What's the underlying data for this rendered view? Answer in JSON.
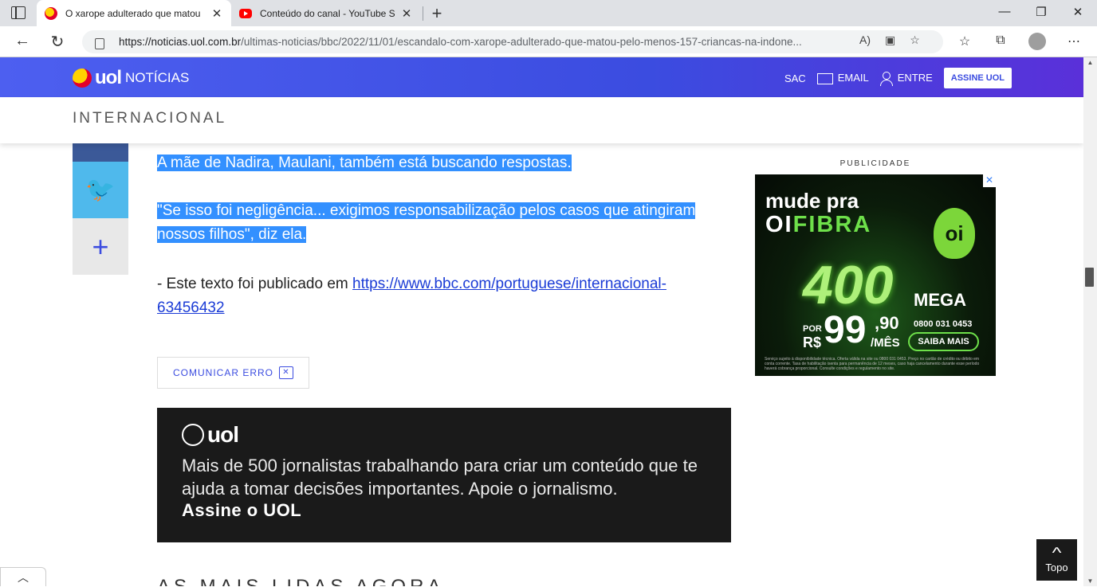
{
  "browser": {
    "tabs": [
      {
        "title": "O xarope adulterado que matou",
        "active": true
      },
      {
        "title": "Conteúdo do canal - YouTube St",
        "active": false
      }
    ],
    "url_host": "https://noticias.uol.com.br",
    "url_path": "/ultimas-noticias/bbc/2022/11/01/escandalo-com-xarope-adulterado-que-matou-pelo-menos-157-criancas-na-indone..."
  },
  "uol": {
    "logo": "uol",
    "section": "NOTÍCIAS",
    "sac": "SAC",
    "email": "EMAIL",
    "entre": "ENTRE",
    "assine": "ASSINE UOL",
    "category": "INTERNACIONAL"
  },
  "article": {
    "p1": "A mãe de Nadira, Maulani, também está buscando respostas.",
    "p2": "\"Se isso foi negligência... exigimos responsabilização pelos casos que atingiram nossos filhos\", diz ela.",
    "p3_prefix": "- Este texto foi publicado em ",
    "p3_link": "https://www.bbc.com/portuguese/internacional-63456432"
  },
  "report": {
    "label": "COMUNICAR ERRO"
  },
  "promo": {
    "logo": "uol",
    "text": "Mais de 500 jornalistas trabalhando para criar um conteúdo que te ajuda a tomar decisões importantes. Apoie o jornalismo.",
    "cta": "Assine o UOL"
  },
  "mais_lidas": "AS MAIS LIDAS AGORA",
  "ad": {
    "label": "PUBLICIDADE",
    "line1": "mude pra",
    "line2a": "OI",
    "line2b": "FIBRA",
    "brand": "oi",
    "speed": "400",
    "mega": "MEGA",
    "por": "POR",
    "rs": "R$",
    "price_int": "99",
    "price_dec": ",90",
    "per": "/MÊS",
    "phone": "0800 031 0453",
    "cta": "SAIBA MAIS",
    "fine": "Serviço sujeito à disponibilidade técnica. Oferta válida na site ou 0800 031 0453. Preço no cartão de crédito ou débito em conta corrente. Taxa de habilitação isenta para permanência de 12 meses, caso haja cancelamento durante esse período haverá cobrança proporcional. Consulte condições e regulamento no site."
  },
  "topo": "Topo"
}
